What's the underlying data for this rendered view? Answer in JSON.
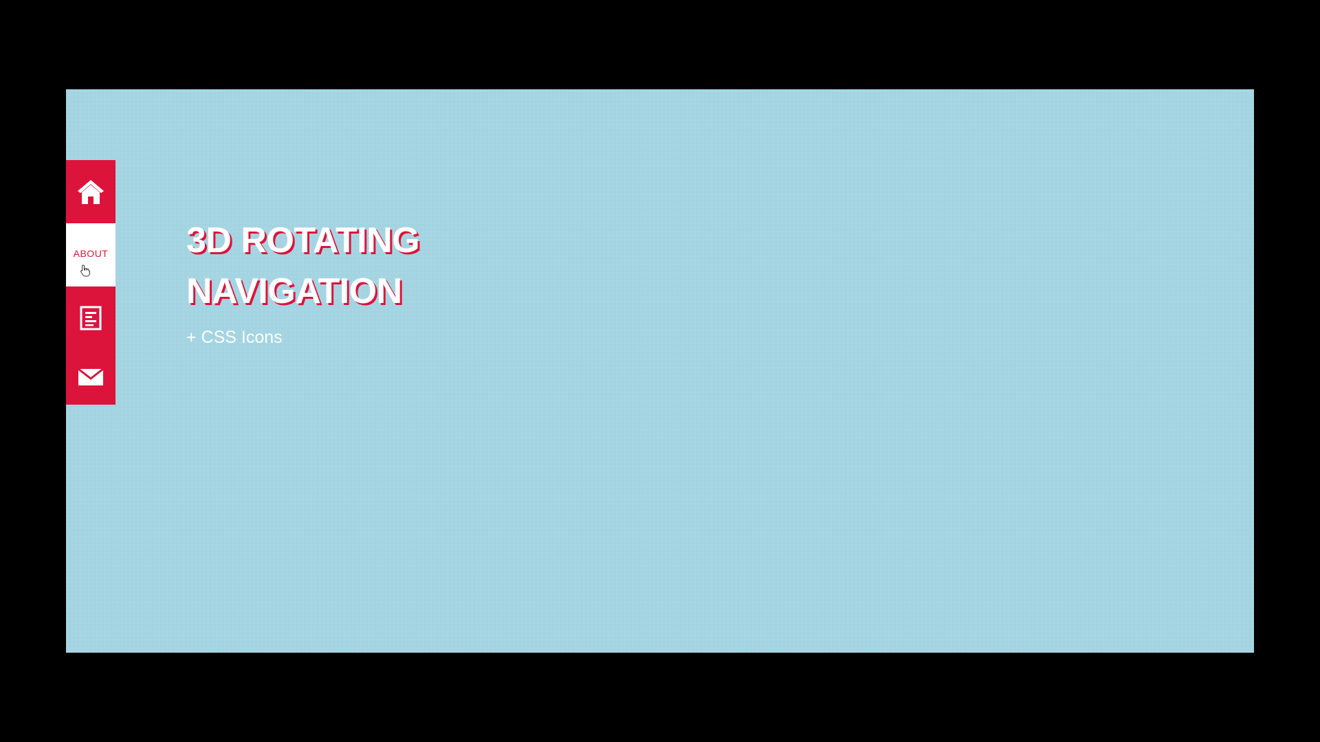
{
  "colors": {
    "accent": "#dc143c",
    "background": "#a4d4e2",
    "frame": "#000000",
    "text": "#ffffff"
  },
  "nav": {
    "items": [
      {
        "id": "home",
        "icon": "home-icon",
        "label": "",
        "active": false
      },
      {
        "id": "about",
        "icon": "",
        "label": "ABOUT",
        "active": true
      },
      {
        "id": "document",
        "icon": "document-icon",
        "label": "",
        "active": false
      },
      {
        "id": "contact",
        "icon": "mail-icon",
        "label": "",
        "active": false
      }
    ]
  },
  "hero": {
    "title_line1": "3D ROTATING",
    "title_line2": "NAVIGATION",
    "subtitle": "+ CSS Icons"
  }
}
